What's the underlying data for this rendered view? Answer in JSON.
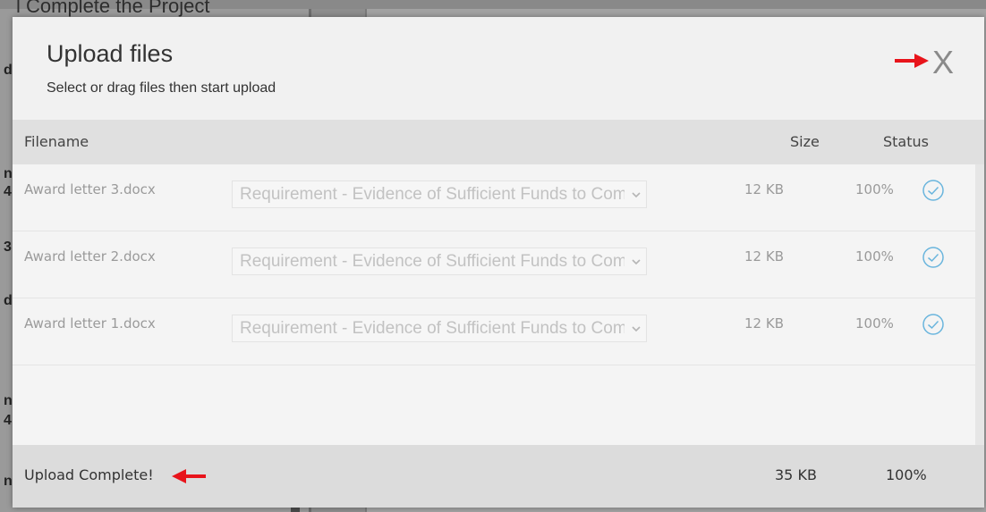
{
  "background": {
    "heading_fragment": "l  Complete the Project",
    "left_letters": [
      "d",
      "n",
      "4",
      "3",
      "d",
      "n",
      "4",
      "n"
    ]
  },
  "modal": {
    "title": "Upload files",
    "subtitle": "Select or drag files then start upload",
    "close_label": "X"
  },
  "table": {
    "columns": {
      "filename": "Filename",
      "size": "Size",
      "status": "Status"
    },
    "rows": [
      {
        "filename": "Award letter 3.docx",
        "requirement": "Requirement - Evidence of Sufficient Funds to Complete the Project",
        "size": "12 KB",
        "progress": "100%",
        "status_icon": "check-circle-icon"
      },
      {
        "filename": "Award letter 2.docx",
        "requirement": "Requirement - Evidence of Sufficient Funds to Complete the Project",
        "size": "12 KB",
        "progress": "100%",
        "status_icon": "check-circle-icon"
      },
      {
        "filename": "Award letter 1.docx",
        "requirement": "Requirement - Evidence of Sufficient Funds to Complete the Project",
        "size": "12 KB",
        "progress": "100%",
        "status_icon": "check-circle-icon"
      }
    ]
  },
  "footer": {
    "status": "Upload Complete!",
    "total_size": "35 KB",
    "total_progress": "100%"
  },
  "colors": {
    "annotation_arrow": "#e8141b",
    "check_icon": "#6ab5dd"
  }
}
